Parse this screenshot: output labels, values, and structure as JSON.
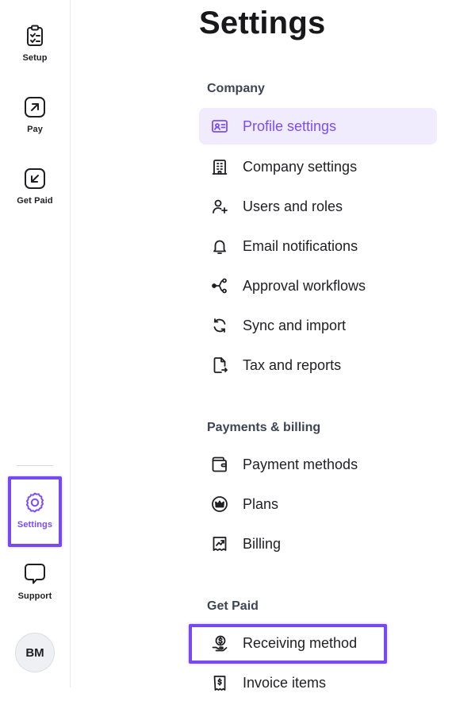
{
  "colors": {
    "accent": "#7b4cff",
    "highlight_border": "#7848f0",
    "active_bg": "#f0ecfd"
  },
  "rail": {
    "items": [
      {
        "label": "Setup",
        "icon": "clipboard-check-icon"
      },
      {
        "label": "Pay",
        "icon": "arrow-up-right-icon"
      },
      {
        "label": "Get Paid",
        "icon": "arrow-down-left-icon"
      },
      {
        "label": "Settings",
        "icon": "gear-icon",
        "active": true
      },
      {
        "label": "Support",
        "icon": "chat-bubble-icon"
      }
    ],
    "avatar_initials": "BM"
  },
  "page": {
    "title": "Settings"
  },
  "sections": [
    {
      "label": "Company",
      "items": [
        {
          "label": "Profile settings",
          "icon": "id-card-icon",
          "active": true
        },
        {
          "label": "Company settings",
          "icon": "building-icon"
        },
        {
          "label": "Users and roles",
          "icon": "user-plus-icon"
        },
        {
          "label": "Email notifications",
          "icon": "bell-icon"
        },
        {
          "label": "Approval workflows",
          "icon": "workflow-icon"
        },
        {
          "label": "Sync and import",
          "icon": "sync-icon"
        },
        {
          "label": "Tax and reports",
          "icon": "document-export-icon"
        }
      ]
    },
    {
      "label": "Payments & billing",
      "items": [
        {
          "label": "Payment methods",
          "icon": "wallet-icon"
        },
        {
          "label": "Plans",
          "icon": "crown-icon"
        },
        {
          "label": "Billing",
          "icon": "receipt-icon"
        }
      ]
    },
    {
      "label": "Get Paid",
      "items": [
        {
          "label": "Receiving method",
          "icon": "money-hand-icon"
        },
        {
          "label": "Invoice items",
          "icon": "invoice-icon"
        }
      ]
    }
  ]
}
